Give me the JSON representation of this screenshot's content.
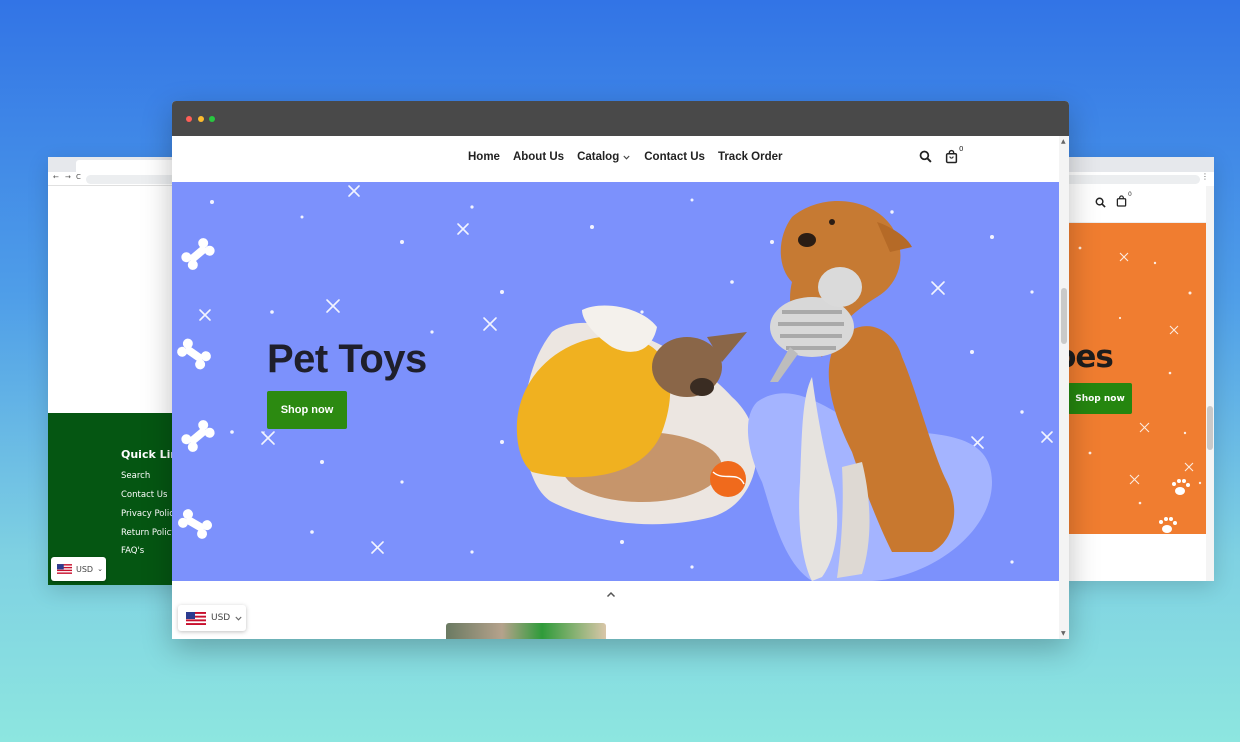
{
  "colors": {
    "background_top": "#3274e6",
    "background_bottom": "#8de6e0",
    "hero_background": "#7c91fc",
    "cta_green": "#2c8a11",
    "footer_green": "#055612",
    "right_banner_orange": "#f07d30"
  },
  "left_window": {
    "footer": {
      "title": "Quick Link",
      "links": [
        "Search",
        "Contact Us",
        "Privacy Policy",
        "Return Policy",
        "FAQ's"
      ]
    },
    "currency": {
      "code": "USD",
      "icon": "us-flag-icon"
    }
  },
  "main_window": {
    "nav": {
      "items": [
        "Home",
        "About Us",
        "Catalog",
        "Contact Us",
        "Track Order"
      ],
      "catalog_icon": "chevron-down-icon"
    },
    "header_icons": {
      "search": "search-icon",
      "cart": "shopping-bag-icon"
    },
    "cart_count": "0",
    "hero": {
      "title": "Pet Toys",
      "cta_label": "Shop now",
      "image": "dog-and-puppy-with-toys"
    },
    "currency": {
      "code": "USD",
      "icon": "us-flag-icon"
    },
    "scroll_top_icon": "chevron-up-icon"
  },
  "right_window": {
    "cart_count": "0",
    "banner": {
      "title_fragment": "hoes",
      "cta_label": "Shop now"
    }
  }
}
